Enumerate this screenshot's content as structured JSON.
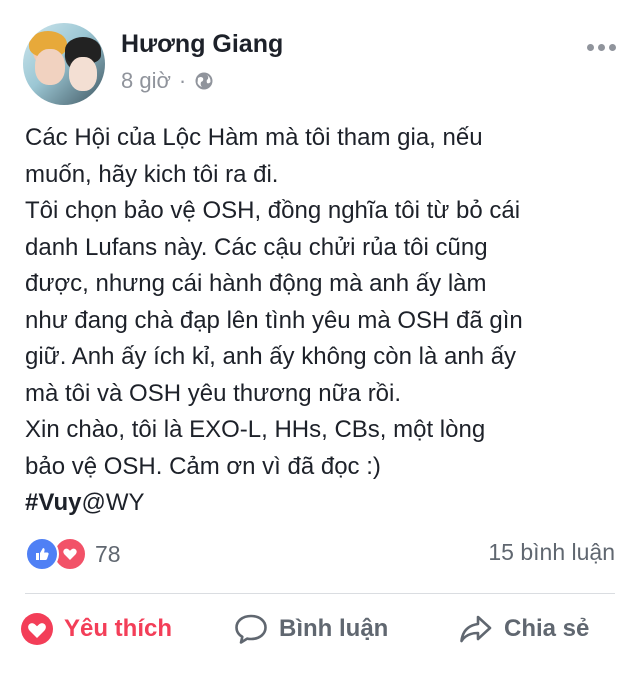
{
  "post": {
    "author": "Hương Giang",
    "time": "8 giờ",
    "separator": "·",
    "privacy_icon": "globe-icon",
    "text_lines": [
      "Các Hội của Lộc Hàm mà tôi tham gia, nếu",
      "muốn, hãy kich tôi ra đi.",
      "Tôi chọn bảo vệ OSH, đồng nghĩa tôi từ bỏ cái",
      "danh Lufans này. Các cậu chửi rủa tôi cũng",
      "được, nhưng cái hành động mà anh ấy làm",
      "như đang chà đạp lên tình yêu mà OSH đã gìn",
      "giữ. Anh ấy ích kỉ, anh ấy không còn là anh ấy",
      "mà tôi và OSH yêu thương nữa rồi.",
      "Xin chào, tôi là EXO-L, HHs, CBs, một lòng",
      "bảo vệ OSH. Cảm ơn vì đã đọc :)"
    ],
    "hashtag": "#Vuy",
    "hashtag_suffix": "@WY"
  },
  "reactions": {
    "count": "78",
    "types": [
      "like-icon",
      "love-icon"
    ]
  },
  "comments_count": "15 bình luận",
  "actions": {
    "like": "Yêu thích",
    "comment": "Bình luận",
    "share": "Chia sẻ"
  },
  "colors": {
    "love": "#f33e58",
    "like": "#4f80f5",
    "secondary_text": "#606770"
  }
}
